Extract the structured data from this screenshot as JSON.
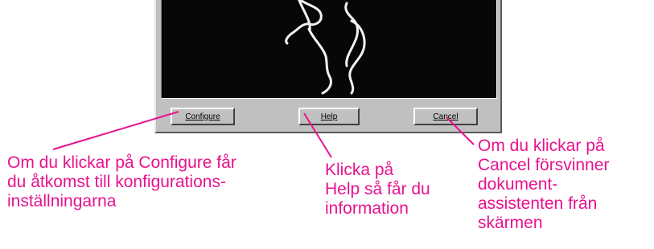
{
  "dialog": {
    "buttons": {
      "configure": "Configure",
      "help": "Help",
      "cancel": "Cancel"
    }
  },
  "callouts": {
    "configure": "Om du klickar på Configure får\ndu åtkomst till konfigurations-\ninställningarna",
    "help": "Klicka på\nHelp så får du\ninformation",
    "cancel": "Om du klickar på\nCancel försvinner\ndokument-\nassistenten från\nskärmen"
  },
  "colors": {
    "callout": "#e8128f",
    "dialog_bg": "#c0c0c0",
    "video_bg": "#070707"
  }
}
